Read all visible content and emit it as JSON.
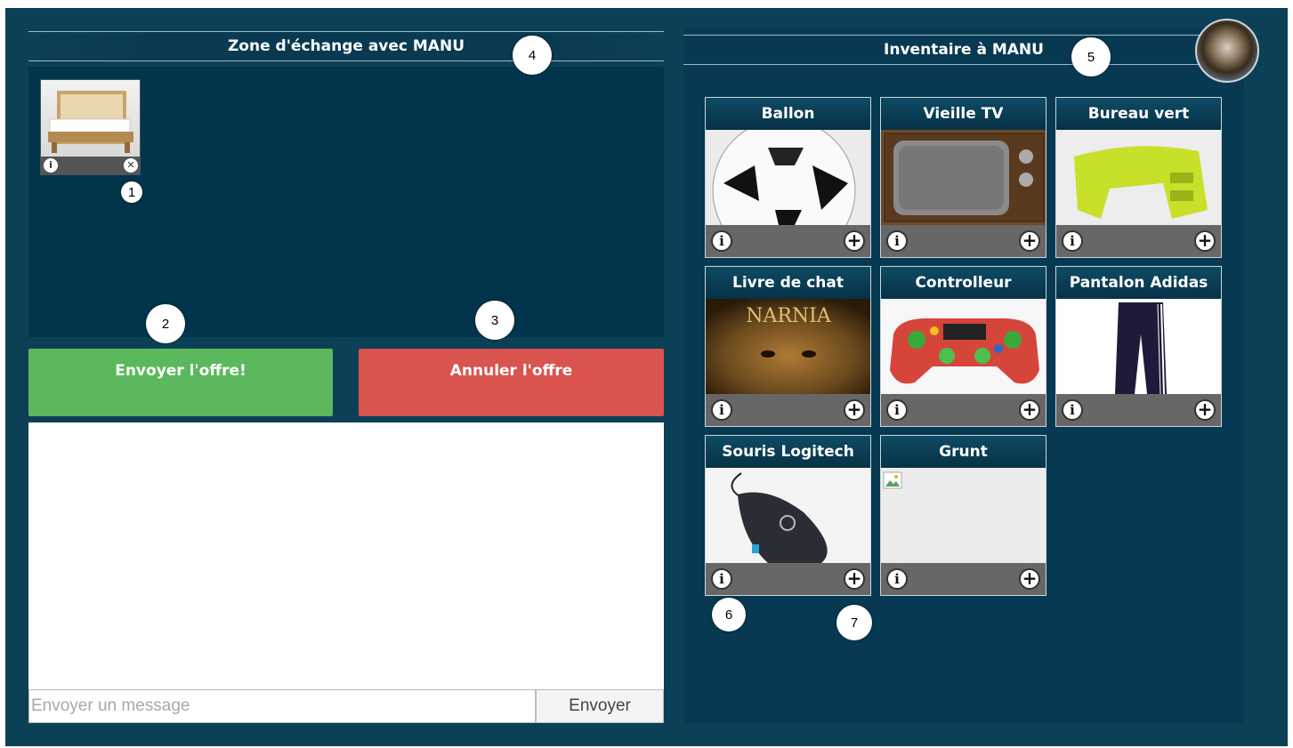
{
  "trade": {
    "header": "Zone d'échange avec MANU",
    "offer_items": [
      {
        "name": "Lit escamotable",
        "image": "folding-bed"
      }
    ]
  },
  "actions": {
    "send_offer": "Envoyer l'offre!",
    "cancel_offer": "Annuler l'offre"
  },
  "chat": {
    "placeholder": "Envoyer un message",
    "value": "",
    "send_label": "Envoyer"
  },
  "inventory": {
    "header": "Inventaire à MANU",
    "items": [
      {
        "title": "Ballon"
      },
      {
        "title": "Vieille TV"
      },
      {
        "title": "Bureau vert"
      },
      {
        "title": "Livre de chat"
      },
      {
        "title": "Controlleur"
      },
      {
        "title": "Pantalon Adidas"
      },
      {
        "title": "Souris Logitech"
      },
      {
        "title": "Grunt"
      }
    ]
  },
  "book_cover_text": "NARNIA",
  "callouts": [
    "1",
    "2",
    "3",
    "4",
    "5",
    "6",
    "7"
  ],
  "colors": {
    "background": "#0c4056",
    "panel": "#02354c",
    "send_button": "#5cb85c",
    "cancel_button": "#d9534f"
  }
}
